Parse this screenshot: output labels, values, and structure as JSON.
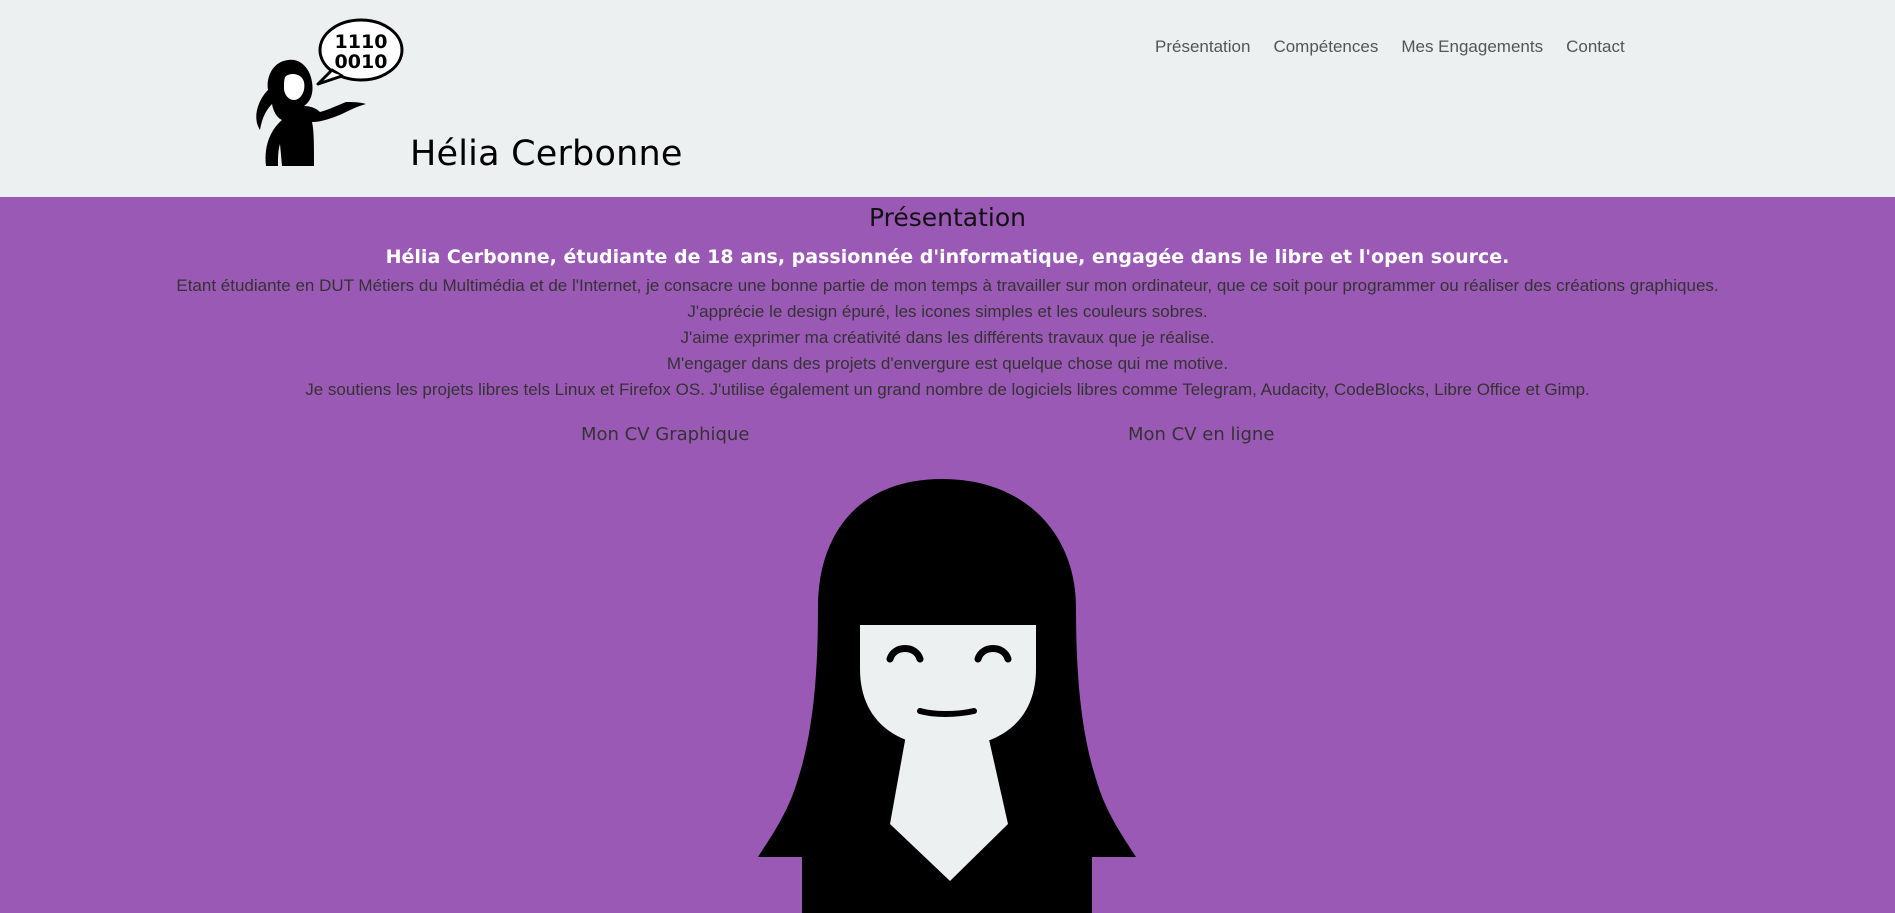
{
  "header": {
    "site_title": "Hélia Cerbonne",
    "logo_bubble_line1": "1110",
    "logo_bubble_line2": "0010"
  },
  "nav": {
    "items": [
      {
        "label": "Présentation"
      },
      {
        "label": "Compétences"
      },
      {
        "label": "Mes Engagements"
      },
      {
        "label": "Contact"
      }
    ]
  },
  "presentation": {
    "title": "Présentation",
    "tagline": "Hélia Cerbonne, étudiante de 18 ans, passionnée d'informatique, engagée dans le libre et l'open source.",
    "paragraphs": [
      "Etant étudiante en DUT Métiers du Multimédia et de l'Internet, je consacre une bonne partie de mon temps à travailler sur mon ordinateur, que ce soit pour programmer ou réaliser des créations graphiques.",
      "J'apprécie le design épuré, les icones simples et les couleurs sobres.",
      "J'aime exprimer ma créativité dans les différents travaux que je réalise.",
      "M'engager dans des projets d'envergure est quelque chose qui me motive.",
      "Je soutiens les projets libres tels Linux et Firefox OS. J'utilise également un grand nombre de logiciels libres comme Telegram, Audacity, CodeBlocks, Libre Office et Gimp."
    ],
    "cv_graphique_label": "Mon CV Graphique",
    "cv_en_ligne_label": "Mon CV en ligne"
  },
  "colors": {
    "header_bg": "#ecf0f1",
    "accent_purple": "#9b59b6",
    "ink": "#000000",
    "skin": "#ecf0f1"
  },
  "icons": {
    "logo": "woman-presenting-speech-bubble-icon",
    "avatar": "girl-avatar-illustration"
  }
}
